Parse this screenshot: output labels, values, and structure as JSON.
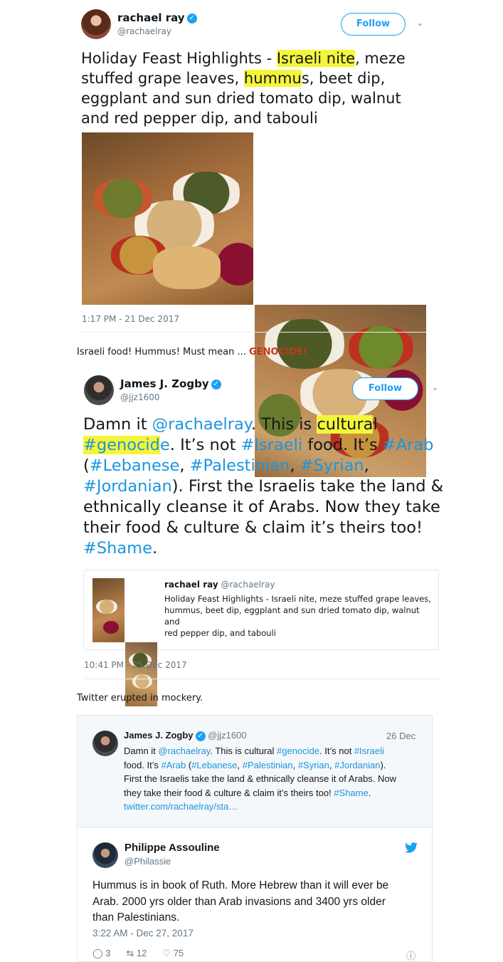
{
  "tweet1": {
    "name": "rachael ray",
    "handle": "@rachaelray",
    "follow": "Follow",
    "text_pre1": "Holiday Feast Highlights - ",
    "text_hl1": "Israeli nite",
    "text_mid1": ", meze",
    "line2_pre": "stuffed grape leaves, ",
    "line2_hl": "hummu",
    "line2_post": "s, beet dip,",
    "line3": "eggplant and sun dried tomato dip, walnut",
    "line4": "and red pepper dip, and tabouli",
    "timestamp": "1:17 PM - 21 Dec 2017"
  },
  "caption1": {
    "text": "Israeli food! Hummus! Must mean ... ",
    "emph": "GENOCIDE!"
  },
  "tweet2": {
    "name": "James J. Zogby",
    "handle": "@jjz1600",
    "follow": "Follow",
    "l1_a": "Damn it ",
    "l1_mention": "@rachaelray",
    "l1_b": ". This is ",
    "l1_hl": "cultura",
    "l1_c": "l",
    "l2_hl": "#genocid",
    "l2_tag_rest": "e",
    "l2_b": ". It’s not ",
    "l2_tag2": "#Israeli",
    "l2_c": " food. It’s ",
    "l2_tag3": "#Arab",
    "l3_a": "(",
    "l3_tag1": "#Lebanese",
    "l3_b": ", ",
    "l3_tag2": "#Palestinian",
    "l3_c": ", ",
    "l3_tag3": "#Syrian",
    "l3_d": ",",
    "l4_tag": "#Jordanian",
    "l4_b": "). First the Israelis take the land &",
    "l5": "ethnically cleanse it of Arabs. Now they take",
    "l6": "their food & culture & claim it’s theirs too!",
    "l7_tag": "#Shame",
    "l7_b": ".",
    "quote": {
      "name": "rachael ray",
      "handle": "@rachaelray",
      "line1": "Holiday Feast Highlights - Israeli nite, meze stuffed grape leaves,",
      "line2": "hummus, beet dip, eggplant and sun dried tomato dip, walnut and",
      "line3": "red pepper dip, and tabouli"
    },
    "timestamp": "10:41 PM - 25 Dec 2017"
  },
  "caption2": {
    "text": "Twitter erupted in mockery."
  },
  "embed1": {
    "name": "James J. Zogby",
    "handle": "@jjz1600",
    "date": "26 Dec",
    "l1_a": "Damn it ",
    "l1_mention": "@rachaelray",
    "l1_b": ". This is cultural ",
    "l1_tag": "#genocide",
    "l1_c": ". It’s not ",
    "l1_tag2": "#Israeli",
    "l2_a": "food. It’s ",
    "l2_tag1": "#Arab",
    "l2_b": " (",
    "l2_tag2": "#Lebanese",
    "l2_c": ", ",
    "l2_tag3": "#Palestinian",
    "l2_d": ", ",
    "l2_tag4": "#Syrian",
    "l2_e": ", ",
    "l2_tag5": "#Jordanian",
    "l2_f": ").",
    "l3": "First the Israelis take the land & ethnically cleanse it of Arabs. Now",
    "l4_a": "they take their food & culture & claim it’s theirs too! ",
    "l4_tag": "#Shame",
    "l4_b": ".",
    "l5_link": "twitter.com/rachaelray/sta…"
  },
  "embed2": {
    "name": "Philippe Assouline",
    "handle": "@Philassie",
    "l1": "Hummus is in book of Ruth. More Hebrew than it will ever be",
    "l2": "Arab. 2000 yrs older than Arab invasions and 3400 yrs older",
    "l3": "than Palestinians.",
    "timestamp": "3:22 AM - Dec 27, 2017",
    "replies": "3",
    "retweets": "12",
    "likes": "75"
  },
  "colors": {
    "accent": "#1da1f2",
    "link": "#1b95e0",
    "highlight": "#f5f53a",
    "emph": "#c0391b"
  }
}
